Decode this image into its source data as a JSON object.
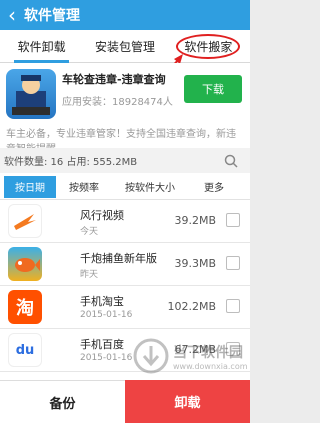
{
  "titlebar": {
    "back_glyph": "‹",
    "title": "软件管理"
  },
  "tabs": [
    {
      "label": "软件卸载"
    },
    {
      "label": "安装包管理"
    },
    {
      "label": "软件搬家"
    }
  ],
  "promo": {
    "name": "车轮查违章-违章查询",
    "installs": "应用安装：18928474人",
    "download_label": "下载",
    "description": "车主必备，专业违章管家！支持全国违章查询，新违章智能提醒。"
  },
  "stats": {
    "text": "软件数量: 16  占用: 555.2MB"
  },
  "sort": {
    "tabs": [
      {
        "label": "按日期"
      },
      {
        "label": "按频率"
      },
      {
        "label": "按软件大小"
      },
      {
        "label": "更多"
      }
    ]
  },
  "apps": [
    {
      "name": "风行视频",
      "date": "今天",
      "size": "39.2MB",
      "icon": "fengxing-icon",
      "color": "#f47a20"
    },
    {
      "name": "千炮捕鱼新年版",
      "date": "昨天",
      "size": "39.3MB",
      "icon": "fishing-icon",
      "color": "#e8a020"
    },
    {
      "name": "手机淘宝",
      "date": "2015-01-16",
      "size": "102.2MB",
      "icon": "taobao-icon",
      "color": "#ff5000",
      "glyph": "淘"
    },
    {
      "name": "手机百度",
      "date": "2015-01-16",
      "size": "67.2MB",
      "icon": "baidu-icon",
      "color": "#2d6ee0",
      "glyph": "du"
    }
  ],
  "bottom": {
    "backup_label": "备份",
    "uninstall_label": "卸载"
  },
  "watermark": {
    "cn": "当下软件园",
    "url": "www.downxia.com"
  },
  "colors": {
    "primary": "#2f9ee0",
    "download": "#22b24c",
    "uninstall": "#ee4343",
    "annotation": "#e02020"
  }
}
